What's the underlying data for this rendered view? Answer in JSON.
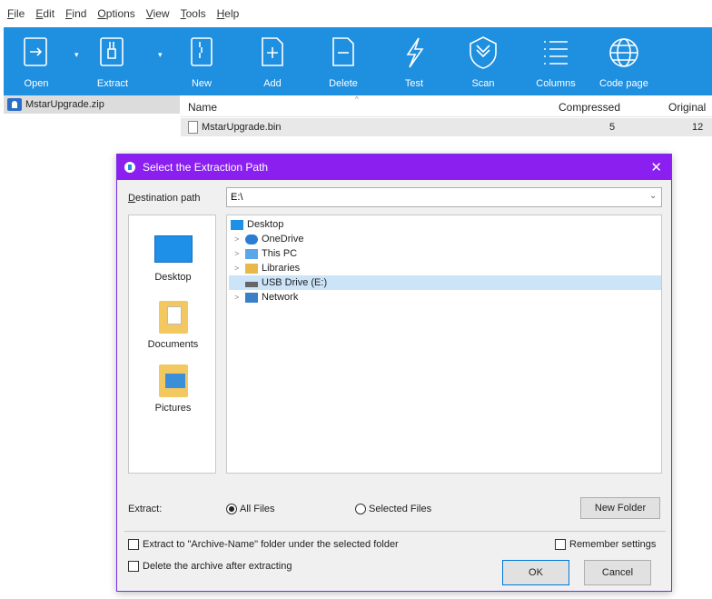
{
  "menu": [
    "File",
    "Edit",
    "Find",
    "Options",
    "View",
    "Tools",
    "Help"
  ],
  "toolbar": {
    "open": "Open",
    "extract": "Extract",
    "new": "New",
    "add": "Add",
    "delete": "Delete",
    "test": "Test",
    "scan": "Scan",
    "columns": "Columns",
    "codepage": "Code page"
  },
  "archive_tree": {
    "root": "MstarUpgrade.zip"
  },
  "file_list": {
    "columns": [
      "Name",
      "Compressed",
      "Original"
    ],
    "rows": [
      {
        "name": "MstarUpgrade.bin",
        "compressed": "5",
        "original": "12"
      }
    ]
  },
  "dialog": {
    "title": "Select the Extraction Path",
    "destination_label": "Destination path",
    "destination_value": "E:\\",
    "places": [
      "Desktop",
      "Documents",
      "Pictures"
    ],
    "tree": [
      "Desktop",
      "OneDrive",
      "This PC",
      "Libraries",
      "USB Drive (E:)",
      "Network"
    ],
    "extract_label": "Extract:",
    "radio_all": "All Files",
    "radio_selected": "Selected Files",
    "new_folder": "New Folder",
    "extract_to_folder": "Extract to \"Archive-Name\" folder under the selected folder",
    "remember": "Remember settings",
    "delete_after": "Delete the archive after extracting",
    "ok": "OK",
    "cancel": "Cancel"
  },
  "colors": {
    "toolbar": "#1f8fe0",
    "dialog_title": "#8a1ff0"
  }
}
